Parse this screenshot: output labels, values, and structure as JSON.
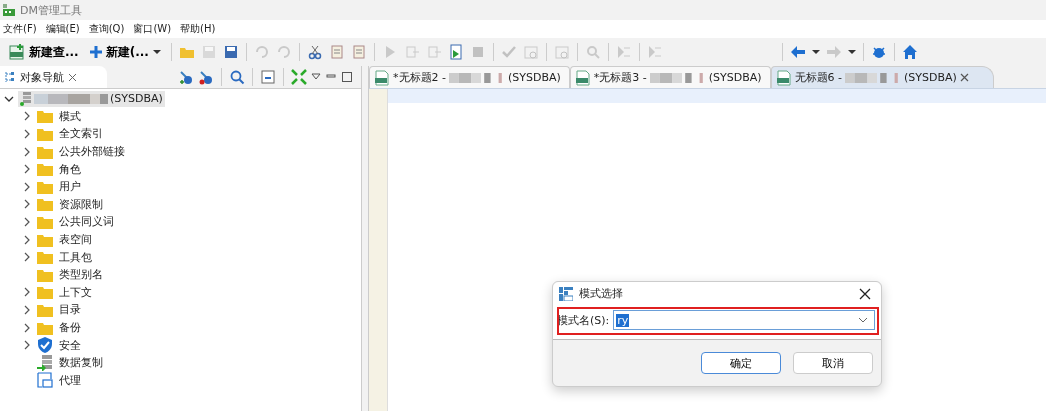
{
  "window": {
    "title": "DM管理工具"
  },
  "menu": [
    "文件(F)",
    "编辑(E)",
    "查询(Q)",
    "窗口(W)",
    "帮助(H)"
  ],
  "toolbar": {
    "new_query": "新建查...",
    "new": "新建(...",
    "tools": [
      {
        "disabled": false
      },
      {
        "disabled": true
      },
      {
        "disabled": false
      },
      {
        "disabled": true
      },
      {
        "disabled": true
      },
      {
        "disabled": false
      },
      {
        "disabled": false
      },
      {
        "disabled": false
      },
      {
        "disabled": true
      },
      {
        "disabled": true
      },
      {
        "disabled": true
      },
      {
        "disabled": false
      },
      {
        "disabled": true
      },
      {
        "disabled": true
      },
      {
        "disabled": true
      },
      {
        "disabled": true
      },
      {
        "disabled": true
      },
      {
        "disabled": true
      },
      {
        "disabled": true
      },
      {
        "disabled": false
      },
      {
        "disabled": true
      },
      {
        "disabled": false
      },
      {
        "disabled": false
      }
    ]
  },
  "navigator": {
    "title": "对象导航",
    "connection": {
      "label": "(SYSDBA)",
      "expanded": true
    },
    "items": [
      {
        "label": "模式",
        "kind": "folder",
        "expandable": true
      },
      {
        "label": "全文索引",
        "kind": "folder",
        "expandable": true
      },
      {
        "label": "公共外部链接",
        "kind": "folder",
        "expandable": true
      },
      {
        "label": "角色",
        "kind": "folder",
        "expandable": true
      },
      {
        "label": "用户",
        "kind": "folder",
        "expandable": true
      },
      {
        "label": "资源限制",
        "kind": "folder",
        "expandable": true
      },
      {
        "label": "公共同义词",
        "kind": "folder",
        "expandable": true
      },
      {
        "label": "表空间",
        "kind": "folder",
        "expandable": true
      },
      {
        "label": "工具包",
        "kind": "folder",
        "expandable": true
      },
      {
        "label": "类型别名",
        "kind": "folder",
        "expandable": false
      },
      {
        "label": "上下文",
        "kind": "folder",
        "expandable": true
      },
      {
        "label": "目录",
        "kind": "folder",
        "expandable": true
      },
      {
        "label": "备份",
        "kind": "folder",
        "expandable": true
      },
      {
        "label": "安全",
        "kind": "shield",
        "expandable": true
      },
      {
        "label": "数据复制",
        "kind": "replication",
        "expandable": false
      },
      {
        "label": "代理",
        "kind": "proxy",
        "expandable": false
      }
    ]
  },
  "editor_tabs": [
    {
      "title": "*无标题2 -",
      "suffix": "(SYSDBA)",
      "selected": false
    },
    {
      "title": "*无标题3 -",
      "suffix": "(SYSDBA)",
      "selected": false
    },
    {
      "title": "无标题6 -",
      "suffix": "(SYSDBA)",
      "selected": true
    }
  ],
  "dialog": {
    "title": "模式选择",
    "field_label": "模式名(S):",
    "value": "ry",
    "buttons": [
      {
        "label": "确定",
        "default": true
      },
      {
        "label": "取消",
        "default": false
      }
    ]
  }
}
